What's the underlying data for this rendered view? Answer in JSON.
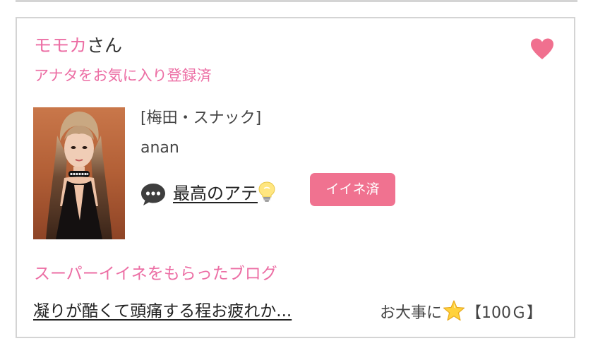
{
  "card": {
    "name": "モモカ",
    "name_suffix": "さん",
    "favorite_status": "アナタをお気に入り登録済",
    "favorite_icon": "heart-icon",
    "shop_line": "[梅田・スナック]",
    "girl_name": "anan",
    "comment_icon": "speech-bubble-icon",
    "post_title": "最高のアテ",
    "post_emoji": "light-bulb-icon",
    "like_button_label": "イイネ済",
    "blog_section_title": "スーパーイイネをもらったブログ",
    "blog_title": "凝りが酷くて頭痛する程お疲れか...",
    "reward_text": "お大事に",
    "reward_icon": "star-icon",
    "reward_amount": "【100Ｇ】"
  },
  "colors": {
    "accent_pink": "#ec6ea4",
    "button_pink": "#f07290",
    "heart_pink": "#f0708f",
    "border_gray": "#d4d4d4"
  }
}
